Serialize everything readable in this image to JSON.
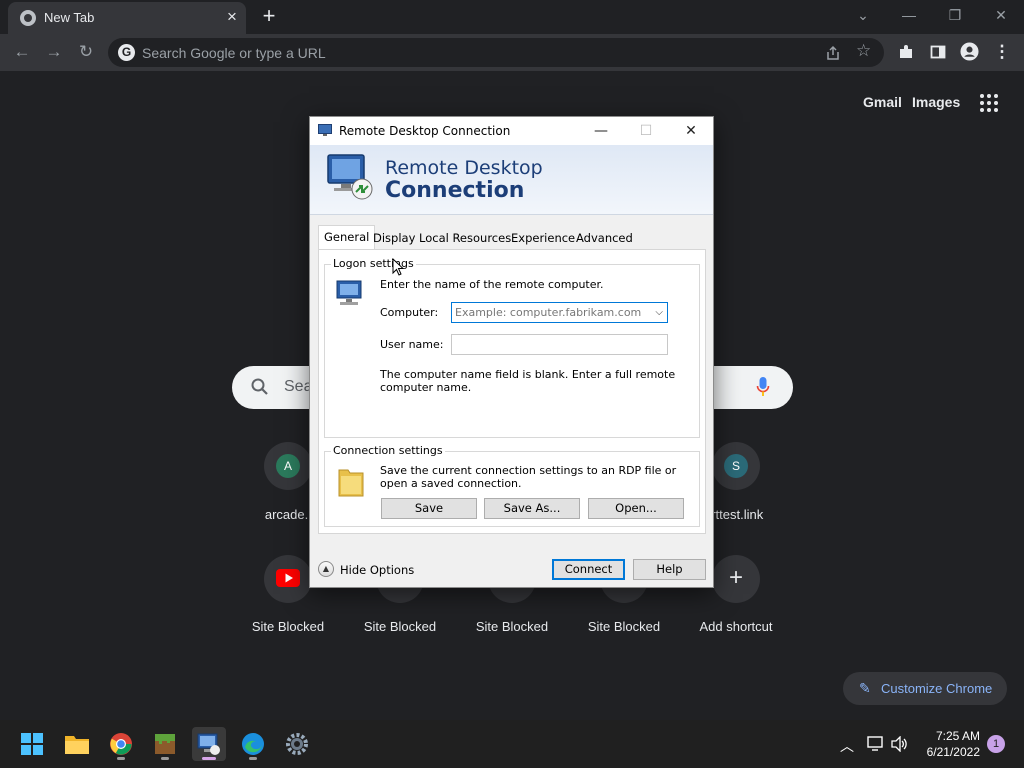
{
  "browser": {
    "tab_title": "New Tab",
    "omnibox_placeholder": "Search Google or type a URL"
  },
  "ntp": {
    "links": {
      "gmail": "Gmail",
      "images": "Images"
    },
    "search_placeholder": "Sea",
    "shortcuts_row1": [
      {
        "letter": "A",
        "label": "arcade.l",
        "color": "#2b7a5c"
      },
      {
        "letter": "S",
        "label": "orttest.link",
        "color": "#2b6a78"
      }
    ],
    "shortcuts_row2": [
      {
        "label": "Site Blocked"
      },
      {
        "label": "Site Blocked"
      },
      {
        "label": "Site Blocked"
      },
      {
        "label": "Site Blocked"
      },
      {
        "label": "Add shortcut"
      }
    ],
    "customize_label": "Customize Chrome"
  },
  "rdp": {
    "title": "Remote Desktop Connection",
    "banner_line1": "Remote Desktop",
    "banner_line2": "Connection",
    "tabs": [
      "General",
      "Display",
      "Local Resources",
      "Experience",
      "Advanced"
    ],
    "logon": {
      "group_label": "Logon settings",
      "instruction": "Enter the name of the remote computer.",
      "computer_label": "Computer:",
      "computer_placeholder": "Example: computer.fabrikam.com",
      "username_label": "User name:",
      "username_value": "",
      "warning": "The computer name field is blank. Enter a full remote computer name."
    },
    "connection": {
      "group_label": "Connection settings",
      "description": "Save the current connection settings to an RDP file or open a saved connection.",
      "save": "Save",
      "save_as": "Save As...",
      "open": "Open..."
    },
    "hide_options": "Hide Options",
    "connect": "Connect",
    "help": "Help"
  },
  "taskbar": {
    "time": "7:25 AM",
    "date": "6/21/2022",
    "notification_count": "1"
  }
}
